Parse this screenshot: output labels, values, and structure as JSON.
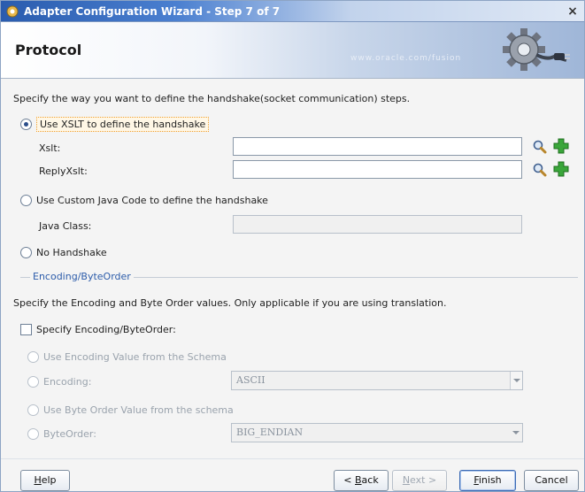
{
  "window": {
    "title": "Adapter Configuration Wizard - Step 7 of 7",
    "close_glyph": "×"
  },
  "header": {
    "page_title": "Protocol",
    "watermark": "www.oracle.com/fusion"
  },
  "handshake": {
    "intro": "Specify the way you want to define the handshake(socket communication) steps.",
    "option_xslt": "Use XSLT to define the handshake",
    "xslt_label": "Xslt:",
    "xslt_value": "",
    "reply_xslt_label": "ReplyXslt:",
    "reply_xslt_value": "",
    "option_java": "Use Custom Java Code to define the handshake",
    "java_class_label": "Java Class:",
    "java_class_value": "",
    "option_none": "No Handshake",
    "selected": "xslt"
  },
  "encoding": {
    "section_title": "Encoding/ByteOrder",
    "intro": "Specify the Encoding and Byte Order values. Only applicable if you are using translation.",
    "specify_checkbox": "Specify Encoding/ByteOrder:",
    "specify_checked": false,
    "use_schema_encoding": "Use Encoding Value from the Schema",
    "encoding_label": "Encoding:",
    "encoding_value": "ASCII",
    "use_schema_byteorder": "Use Byte Order Value from the schema",
    "byteorder_label": "ByteOrder:",
    "byteorder_value": "BIG_ENDIAN"
  },
  "footer": {
    "help_label": "Help",
    "help_mnemonic": "H",
    "help_rest": "elp",
    "back_prefix": "< ",
    "back_mnemonic": "B",
    "back_rest": "ack",
    "next_mnemonic": "N",
    "next_rest": "ext >",
    "finish_mnemonic": "F",
    "finish_rest": "inish",
    "cancel_label": "Cancel"
  },
  "colors": {
    "accent": "#2c5caa",
    "add_icon": "#2e9a2e",
    "focus_outline": "#f0a030"
  },
  "icons": [
    "app-icon",
    "close-icon",
    "gear-plug-icon",
    "search-icon",
    "add-icon"
  ]
}
